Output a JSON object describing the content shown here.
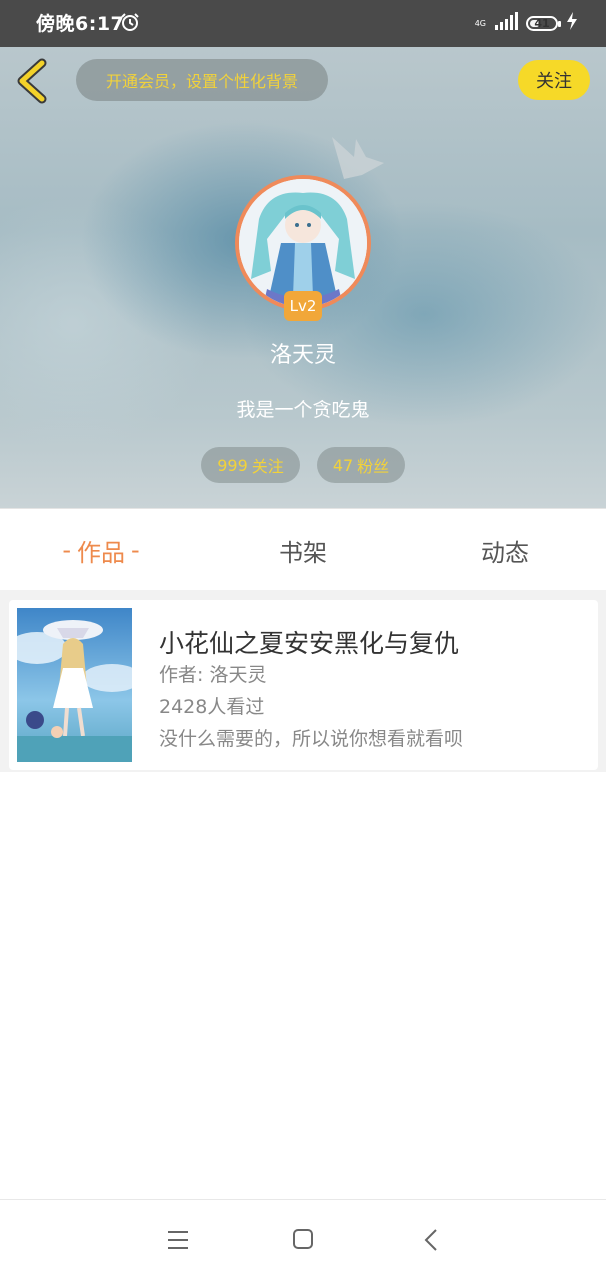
{
  "status_bar": {
    "time": "傍晚6:17",
    "network": "4G",
    "battery": "41",
    "battery_level": 0.41
  },
  "header": {
    "vip_banner": "开通会员，设置个性化背景",
    "follow_label": "关注",
    "level": "Lv2",
    "username": "洛天灵",
    "bio": "我是一个贪吃鬼",
    "following_count": "999",
    "following_label": "关注",
    "fans_count": "47",
    "fans_label": "粉丝"
  },
  "tabs": [
    {
      "label": "作品",
      "active": true
    },
    {
      "label": "书架",
      "active": false
    },
    {
      "label": "动态",
      "active": false
    }
  ],
  "books": [
    {
      "title": "小花仙之夏安安黑化与复仇",
      "author": "作者: 洛天灵",
      "views": "2428人看过",
      "description": "没什么需要的，所以说你想看就看呗"
    }
  ],
  "colors": {
    "accent_orange": "#ee8a4c",
    "accent_yellow": "#f6d928",
    "status_bar": "#4a4a4a"
  },
  "icons": [
    "alarm-icon",
    "signal-icon",
    "battery-icon",
    "charging-icon",
    "back-icon",
    "crown-icon",
    "menu-icon",
    "home-icon",
    "back-nav-icon"
  ]
}
